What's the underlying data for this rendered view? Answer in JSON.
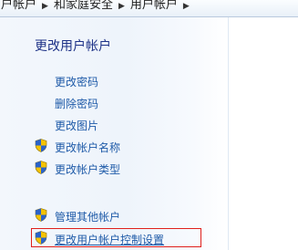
{
  "breadcrumb": {
    "items": [
      "用户帐户",
      "和家庭安全",
      "用户帐户"
    ]
  },
  "pane": {
    "title": "更改用户帐户",
    "tasks": [
      {
        "label": "更改密码",
        "icon": "none"
      },
      {
        "label": "删除密码",
        "icon": "none"
      },
      {
        "label": "更改图片",
        "icon": "none"
      },
      {
        "label": "更改帐户名称",
        "icon": "uac-shield-icon"
      },
      {
        "label": "更改帐户类型",
        "icon": "uac-shield-icon"
      }
    ],
    "other_tasks": [
      {
        "label": "管理其他帐户",
        "icon": "uac-shield-icon"
      },
      {
        "label": "更改用户帐户控制设置",
        "icon": "uac-shield-icon",
        "highlighted": true
      }
    ]
  },
  "colors": {
    "link": "#1e5aa8",
    "title": "#1e3287",
    "highlight_border": "#e0201c"
  }
}
